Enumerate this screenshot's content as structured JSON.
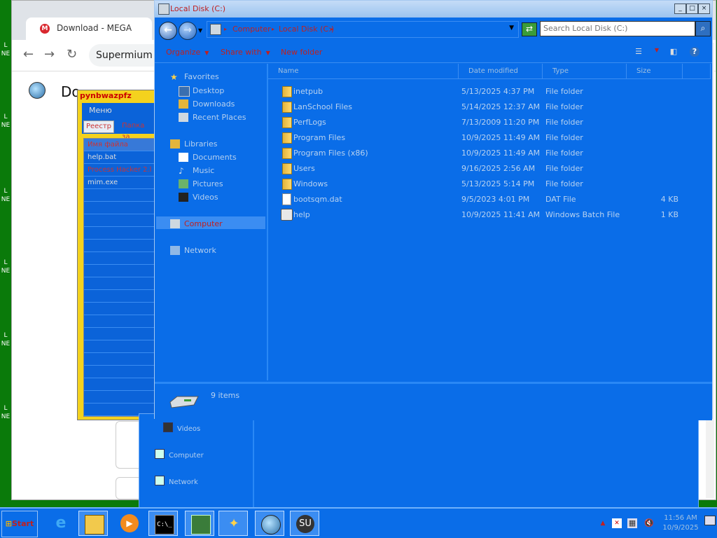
{
  "desktop": {
    "labels": [
      "L",
      "NE",
      "L",
      "NE",
      "L",
      "NE",
      "L",
      "NE",
      "L",
      "NE",
      "L",
      "NE"
    ]
  },
  "browser": {
    "tab_title": "Download - MEGA",
    "tab_icon_letter": "M",
    "omnibox_text": "Supermium",
    "body_text": "Do"
  },
  "rusapp": {
    "title": "pynbwazpfz",
    "menu": "Меню",
    "tabs": [
      "Реестр",
      "Папка за"
    ],
    "list": {
      "header": "Имя файла",
      "rows": [
        "help.bat",
        "Process Hacker 2.l",
        "mim.exe"
      ]
    }
  },
  "explorer_back": {
    "nav": [
      "Videos",
      "Computer",
      "Network"
    ]
  },
  "explorer": {
    "title": "Local Disk (C:)",
    "breadcrumb": [
      "Computer",
      "Local Disk (C:)"
    ],
    "search_placeholder": "Search Local Disk (C:)",
    "toolbar": {
      "organize": "Organize",
      "share_with": "Share with",
      "new_folder": "New folder"
    },
    "nav": {
      "favorites": "Favorites",
      "desktop": "Desktop",
      "downloads": "Downloads",
      "recent_places": "Recent Places",
      "libraries": "Libraries",
      "documents": "Documents",
      "music": "Music",
      "pictures": "Pictures",
      "videos": "Videos",
      "computer": "Computer",
      "network": "Network"
    },
    "columns": [
      "Name",
      "Date modified",
      "Type",
      "Size"
    ],
    "files": [
      {
        "name": "inetpub",
        "date": "5/13/2025 4:37 PM",
        "type": "File folder",
        "size": "",
        "kind": "folder"
      },
      {
        "name": "LanSchool Files",
        "date": "5/14/2025 12:37 AM",
        "type": "File folder",
        "size": "",
        "kind": "folder"
      },
      {
        "name": "PerfLogs",
        "date": "7/13/2009 11:20 PM",
        "type": "File folder",
        "size": "",
        "kind": "folder"
      },
      {
        "name": "Program Files",
        "date": "10/9/2025 11:49 AM",
        "type": "File folder",
        "size": "",
        "kind": "folder"
      },
      {
        "name": "Program Files (x86)",
        "date": "10/9/2025 11:49 AM",
        "type": "File folder",
        "size": "",
        "kind": "folder"
      },
      {
        "name": "Users",
        "date": "9/16/2025 2:56 AM",
        "type": "File folder",
        "size": "",
        "kind": "folder"
      },
      {
        "name": "Windows",
        "date": "5/13/2025 5:14 PM",
        "type": "File folder",
        "size": "",
        "kind": "folder"
      },
      {
        "name": "bootsqm.dat",
        "date": "9/5/2023 4:01 PM",
        "type": "DAT File",
        "size": "4 KB",
        "kind": "file"
      },
      {
        "name": "help",
        "date": "10/9/2025 11:41 AM",
        "type": "Windows Batch File",
        "size": "1 KB",
        "kind": "bat"
      }
    ],
    "status_count": "9 items"
  },
  "taskbar": {
    "start": "Start",
    "clock_time": "11:56 AM",
    "clock_date": "10/9/2025",
    "apps": [
      "ie-icon",
      "explorer-icon",
      "media-icon",
      "cmd-icon",
      "taskmgr-icon",
      "wand-icon",
      "globe-icon",
      "supermium-icon"
    ],
    "su_label": "SU",
    "cmd_label": "C:\\_"
  }
}
